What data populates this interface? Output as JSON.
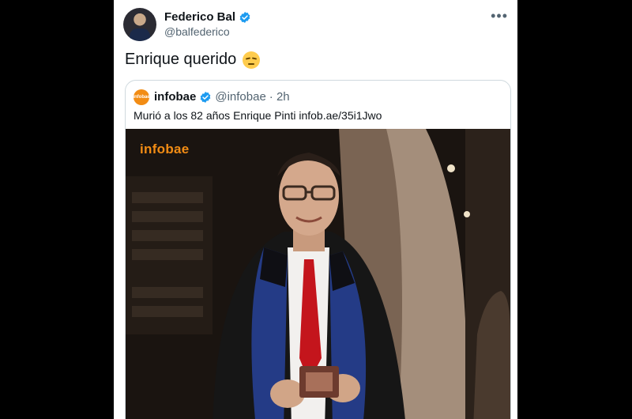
{
  "tweet": {
    "author_name": "Federico Bal",
    "author_handle": "@balfederico",
    "text": "Enrique querido",
    "more_icon": "more-icon"
  },
  "quoted": {
    "author_name": "infobae",
    "author_handle": "@infobae",
    "time": "· 2h",
    "text": "Murió a los 82 años Enrique Pinti infob.ae/35i1Jwo",
    "logo_label": "infobae",
    "image": {
      "watermark": "infobae"
    }
  },
  "colors": {
    "verified": "#1d9bf0",
    "infobae_orange": "#f28c14"
  }
}
